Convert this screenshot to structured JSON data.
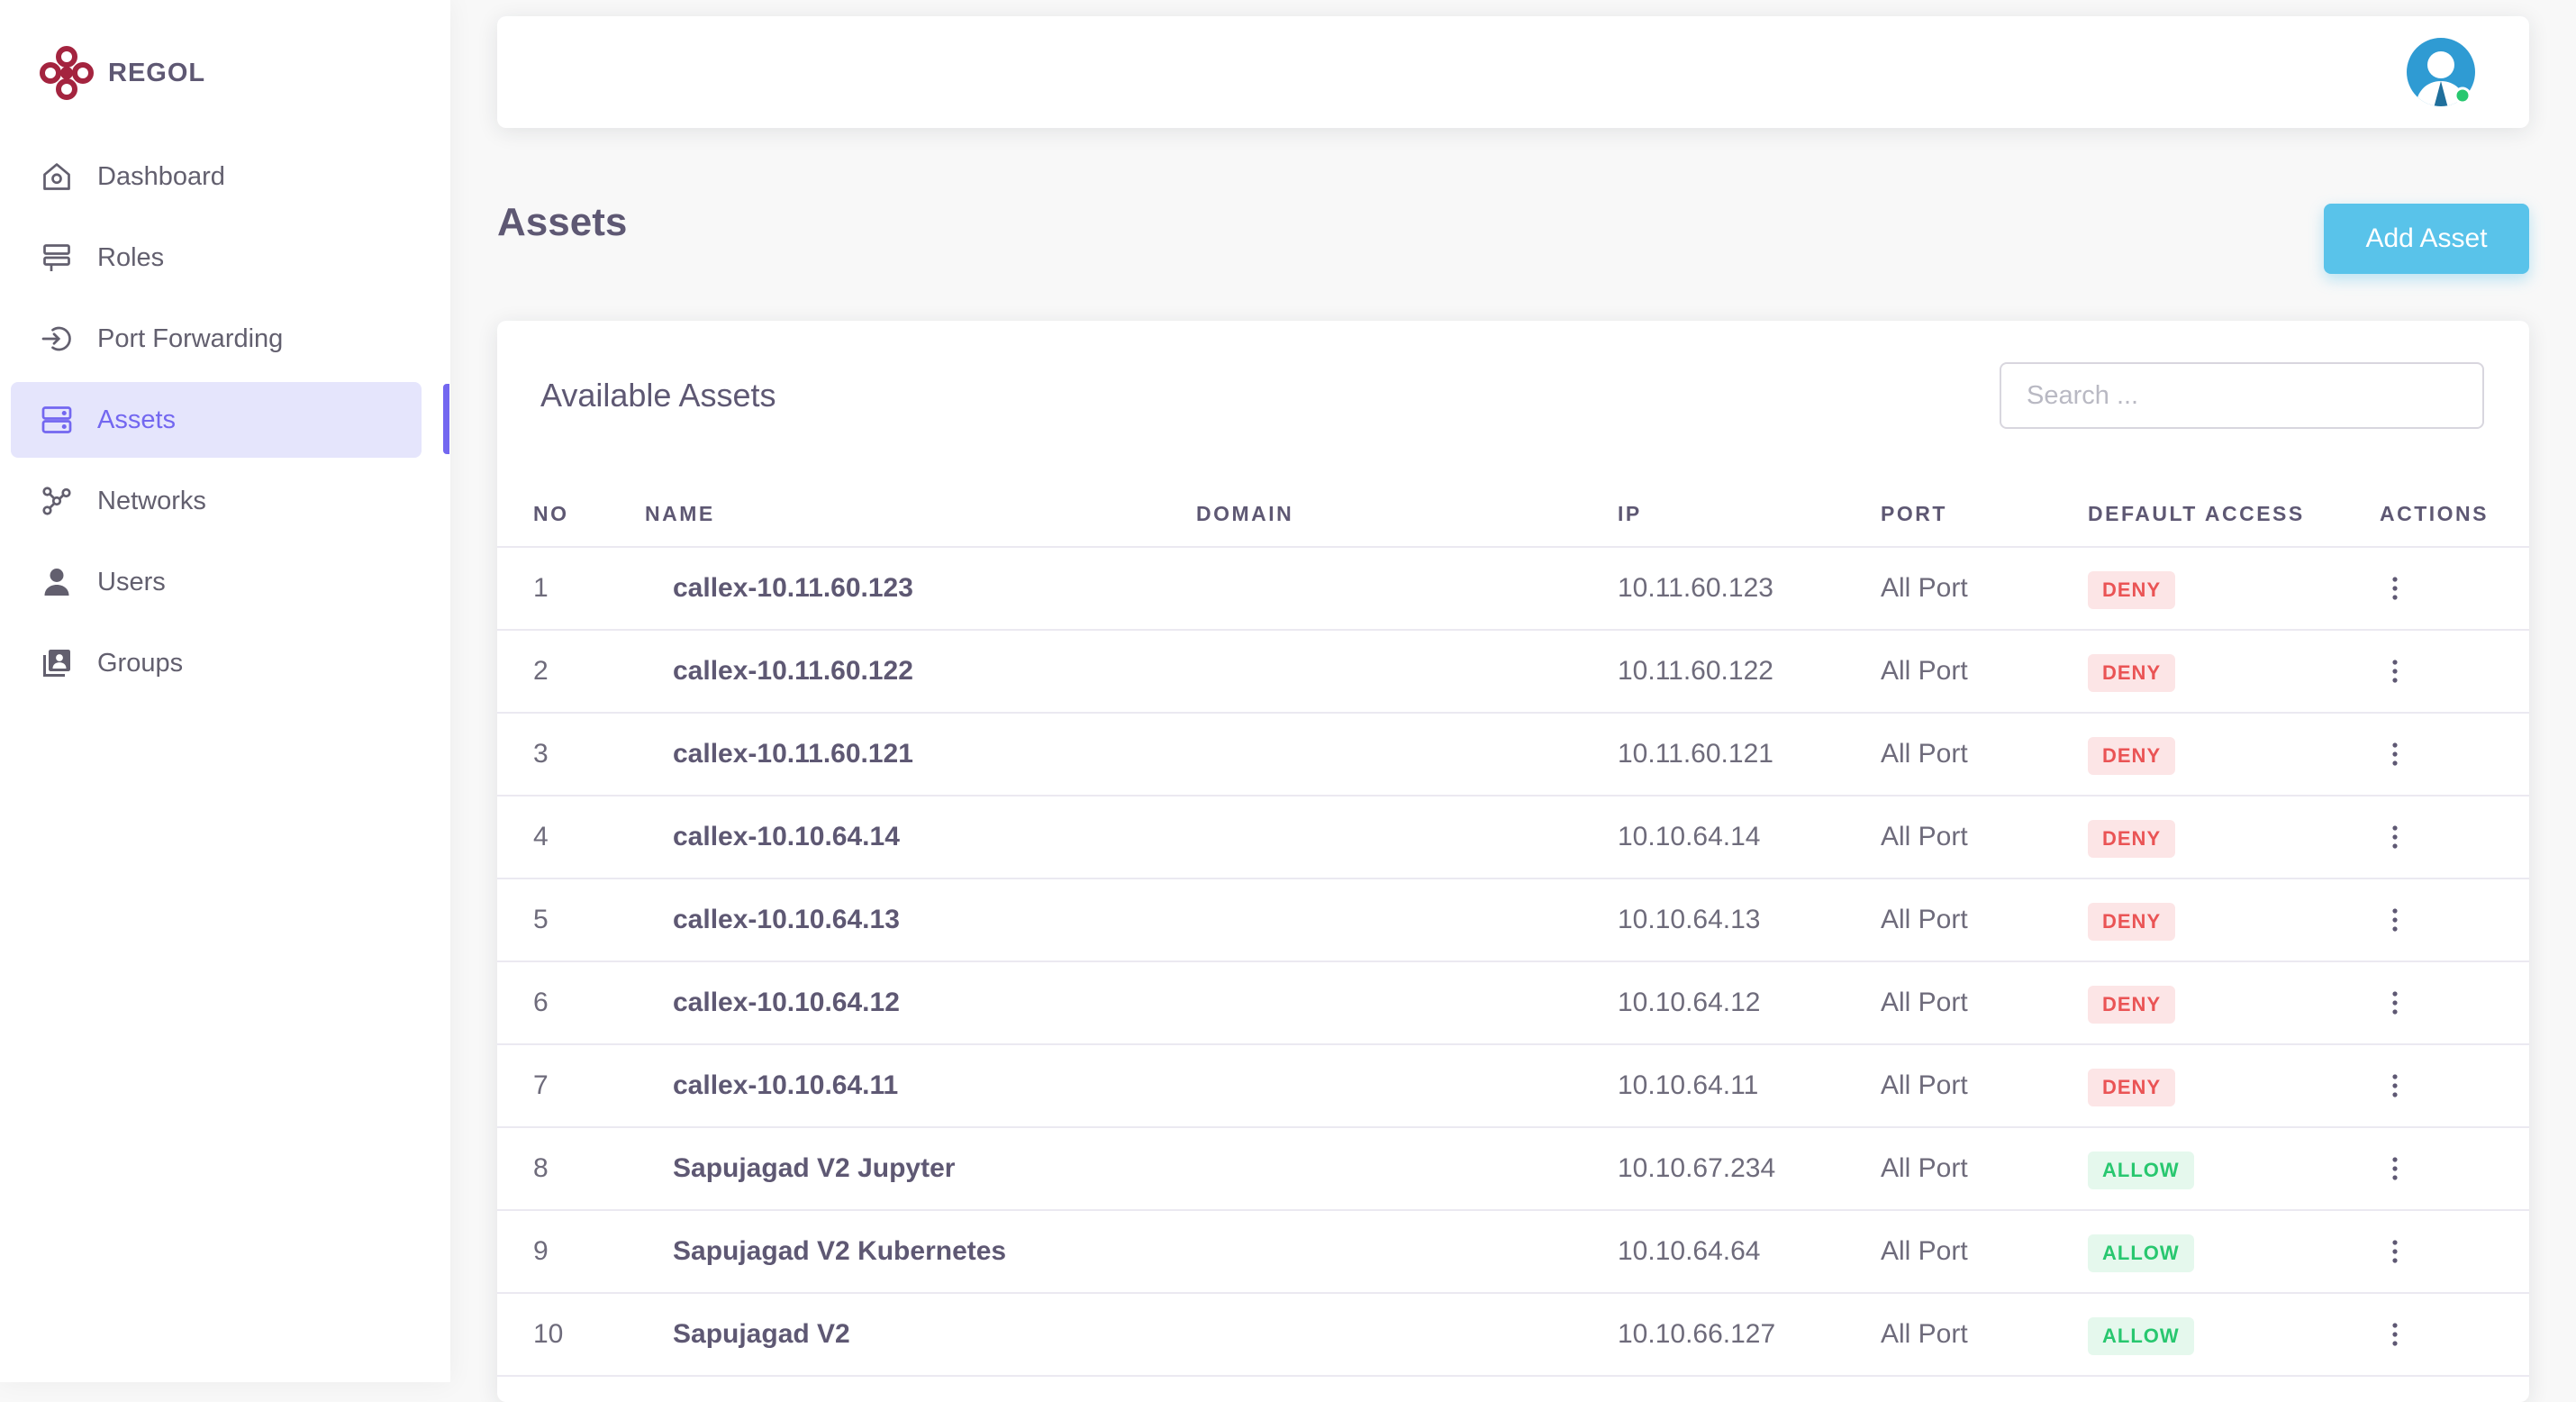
{
  "brand": {
    "name": "REGOL",
    "logo_color": "#a4243f"
  },
  "sidebar": {
    "items": [
      {
        "label": "Dashboard",
        "icon": "home-icon"
      },
      {
        "label": "Roles",
        "icon": "roles-icon"
      },
      {
        "label": "Port Forwarding",
        "icon": "login-arrow-icon"
      },
      {
        "label": "Assets",
        "icon": "server-icon",
        "active": true
      },
      {
        "label": "Networks",
        "icon": "network-icon"
      },
      {
        "label": "Users",
        "icon": "user-icon"
      },
      {
        "label": "Groups",
        "icon": "groups-icon"
      }
    ]
  },
  "page": {
    "title": "Assets",
    "add_button": "Add Asset"
  },
  "card": {
    "title": "Available Assets",
    "search_placeholder": "Search ..."
  },
  "table": {
    "headers": {
      "no": "NO",
      "name": "NAME",
      "domain": "DOMAIN",
      "ip": "IP",
      "port": "PORT",
      "access": "DEFAULT ACCESS",
      "actions": "ACTIONS"
    },
    "rows": [
      {
        "no": "1",
        "name": "callex-10.11.60.123",
        "domain": "",
        "ip": "10.11.60.123",
        "port": "All Port",
        "access": "DENY"
      },
      {
        "no": "2",
        "name": "callex-10.11.60.122",
        "domain": "",
        "ip": "10.11.60.122",
        "port": "All Port",
        "access": "DENY"
      },
      {
        "no": "3",
        "name": "callex-10.11.60.121",
        "domain": "",
        "ip": "10.11.60.121",
        "port": "All Port",
        "access": "DENY"
      },
      {
        "no": "4",
        "name": "callex-10.10.64.14",
        "domain": "",
        "ip": "10.10.64.14",
        "port": "All Port",
        "access": "DENY"
      },
      {
        "no": "5",
        "name": "callex-10.10.64.13",
        "domain": "",
        "ip": "10.10.64.13",
        "port": "All Port",
        "access": "DENY"
      },
      {
        "no": "6",
        "name": "callex-10.10.64.12",
        "domain": "",
        "ip": "10.10.64.12",
        "port": "All Port",
        "access": "DENY"
      },
      {
        "no": "7",
        "name": "callex-10.10.64.11",
        "domain": "",
        "ip": "10.10.64.11",
        "port": "All Port",
        "access": "DENY"
      },
      {
        "no": "8",
        "name": "Sapujagad V2 Jupyter",
        "domain": "",
        "ip": "10.10.67.234",
        "port": "All Port",
        "access": "ALLOW"
      },
      {
        "no": "9",
        "name": "Sapujagad V2 Kubernetes",
        "domain": "",
        "ip": "10.10.64.64",
        "port": "All Port",
        "access": "ALLOW"
      },
      {
        "no": "10",
        "name": "Sapujagad V2",
        "domain": "",
        "ip": "10.10.66.127",
        "port": "All Port",
        "access": "ALLOW"
      }
    ]
  },
  "colors": {
    "accent": "#7367f0",
    "button": "#59c3ea",
    "deny": "#ea5455",
    "allow": "#28c76f"
  }
}
